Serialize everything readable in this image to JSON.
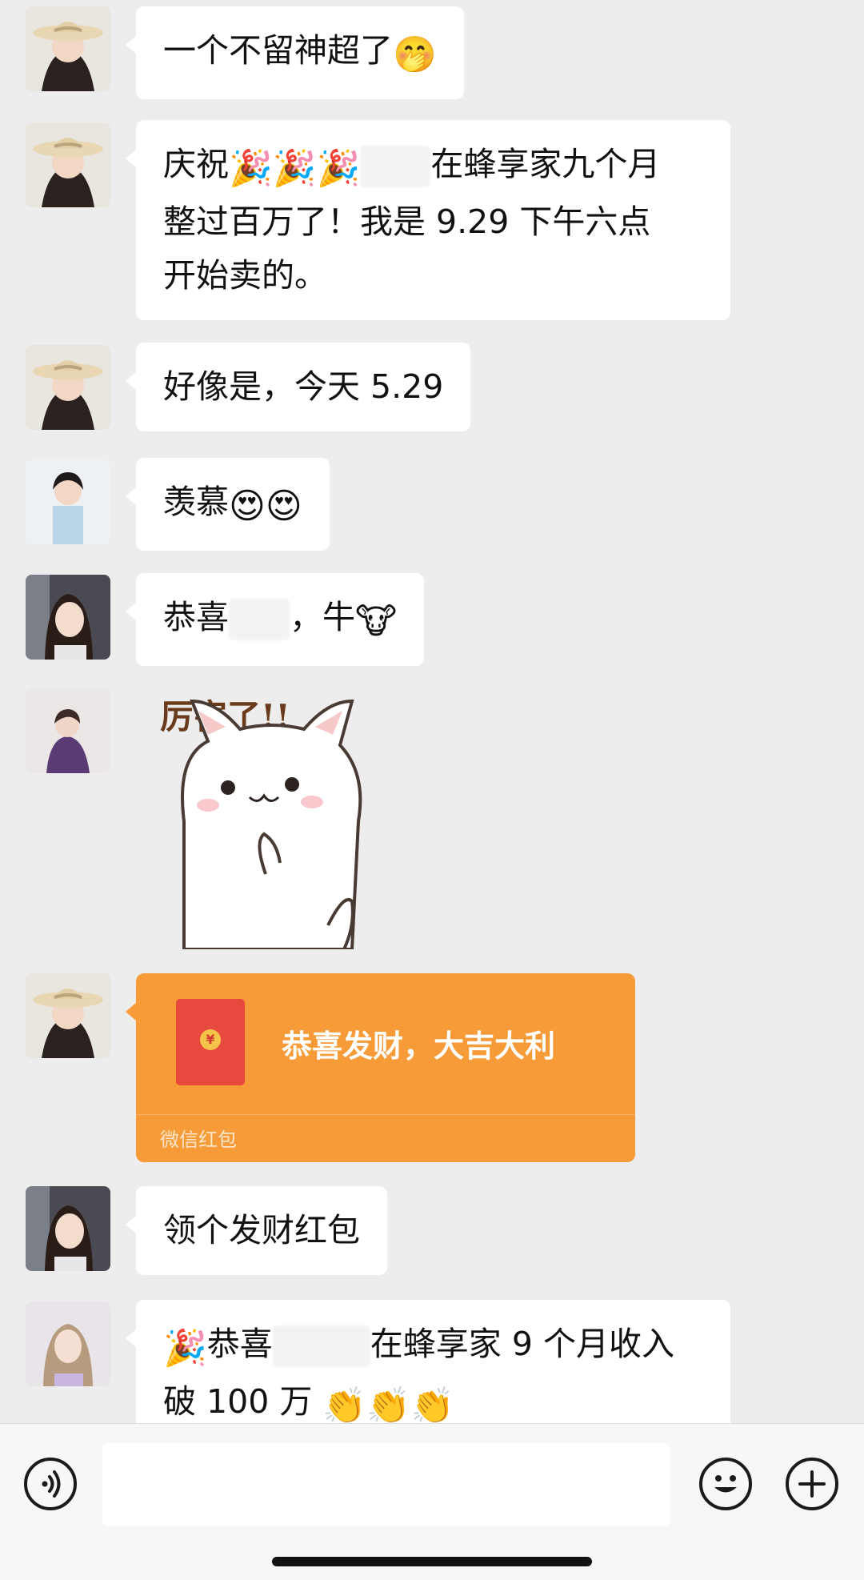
{
  "messages": [
    {
      "sender": "hat-lady",
      "text": "一个不留神超了",
      "emoji": "🤭"
    },
    {
      "sender": "hat-lady",
      "line1_prefix": "庆祝",
      "line1_emoji": "🎉🎉🎉",
      "line1_suffix": "在蜂享家九个月",
      "line2": "整过百万了！我是 9.29 下午六点",
      "line3": "开始卖的。"
    },
    {
      "sender": "hat-lady",
      "text": "好像是，今天 5.29"
    },
    {
      "sender": "short-hair-lady",
      "text": "羡慕",
      "emoji": "😍😍"
    },
    {
      "sender": "long-hair-lady",
      "prefix": "恭喜",
      "suffix": "，牛",
      "emoji": "🐮"
    },
    {
      "sender": "purple-lady",
      "sticker_text": "厉害了!!"
    },
    {
      "sender": "hat-lady",
      "type": "red_packet",
      "title": "恭喜发财，大吉大利",
      "footer": "微信红包",
      "coin": "¥"
    },
    {
      "sender": "long-hair-lady",
      "text": "领个发财红包"
    },
    {
      "sender": "blonde-lady",
      "line1_emoji": "🎉",
      "line1_prefix": "恭喜",
      "line1_suffix": "在蜂享家 9 个月收入",
      "line2": "破 100 万",
      "line2_emoji": "👏👏👏"
    }
  ],
  "input": {
    "placeholder": ""
  },
  "colors": {
    "background": "#ededed",
    "bubble": "#ffffff",
    "red_packet": "#f79b38",
    "envelope": "#e8493e"
  },
  "icons": {
    "voice": "voice-icon",
    "emoji": "emoji-icon",
    "plus": "plus-icon"
  }
}
